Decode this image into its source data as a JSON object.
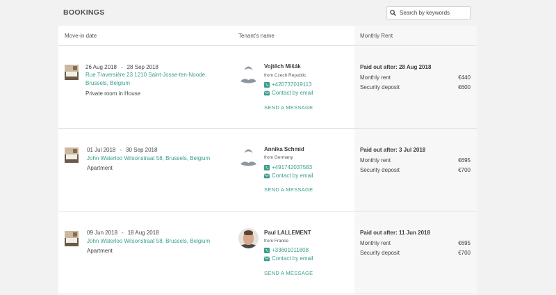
{
  "page": {
    "title": "BOOKINGS"
  },
  "search": {
    "placeholder": "Search by keywords"
  },
  "columns": {
    "move_in": "Move-in date",
    "tenant": "Tenant's name",
    "rent": "Monthly Rent"
  },
  "colors": {
    "accent": "#3a9e8d",
    "background": "#f2f2f2"
  },
  "bookings": [
    {
      "start": "26 Aug 2018",
      "sep": "-",
      "end": "28 Sep 2018",
      "address": "Rue Traversière 23 1210 Saint-Josse-ten-Noode, Brussels, Belgium",
      "type": "Private room in House",
      "tenant": {
        "name": "Vojtěch Mišák",
        "from": "from Czech Republic",
        "phone": "+420737019113",
        "email": "Contact by email",
        "message": "SEND A MESSAGE",
        "avatar": "default-avatar-icon"
      },
      "rent": {
        "paid_out": "Paid out after: 28 Aug 2018",
        "monthly_label": "Monthly rent",
        "monthly": "€440",
        "deposit_label": "Security deposit",
        "deposit": "€600"
      }
    },
    {
      "start": "01 Jul 2018",
      "sep": "-",
      "end": "30 Sep 2018",
      "address": "John Waterloo Wilsonstraat 58, Brussels, Belgium",
      "type": "Apartment",
      "tenant": {
        "name": "Annika Schmid",
        "from": "from Germany",
        "phone": "+491742037583",
        "email": "Contact by email",
        "message": "SEND A MESSAGE",
        "avatar": "default-avatar-icon"
      },
      "rent": {
        "paid_out": "Paid out after: 3 Jul 2018",
        "monthly_label": "Monthly rent",
        "monthly": "€695",
        "deposit_label": "Security deposit",
        "deposit": "€700"
      }
    },
    {
      "start": "09 Jun 2018",
      "sep": "-",
      "end": "18 Aug 2018",
      "address": "John Waterloo Wilsonstraat 58, Brussels, Belgium",
      "type": "Apartment",
      "tenant": {
        "name": "Paul LALLEMENT",
        "from": "from France",
        "phone": "+33601011808",
        "email": "Contact by email",
        "message": "SEND A MESSAGE",
        "avatar": "user-photo"
      },
      "rent": {
        "paid_out": "Paid out after: 11 Jun 2018",
        "monthly_label": "Monthly rent",
        "monthly": "€695",
        "deposit_label": "Security deposit",
        "deposit": "€700"
      }
    }
  ]
}
